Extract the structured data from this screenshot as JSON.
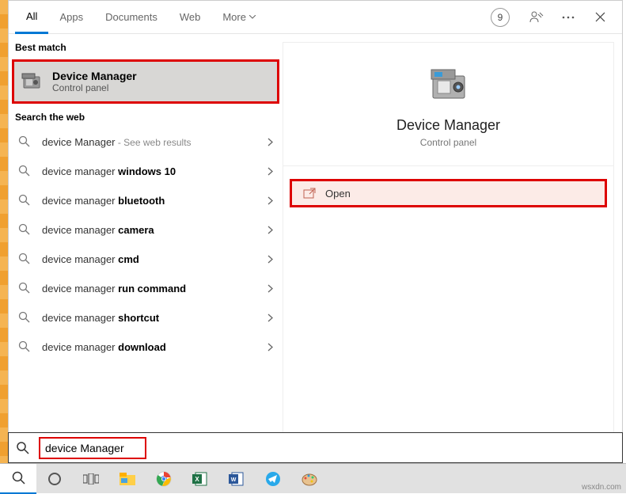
{
  "header": {
    "tabs": [
      "All",
      "Apps",
      "Documents",
      "Web",
      "More"
    ],
    "badge": "9"
  },
  "sections": {
    "best_match": "Best match",
    "search_web": "Search the web"
  },
  "best_match": {
    "title": "Device Manager",
    "subtitle": "Control panel"
  },
  "web_results": [
    {
      "prefix": "device Manager",
      "bold": "",
      "hint": " - See web results"
    },
    {
      "prefix": "device manager ",
      "bold": "windows 10",
      "hint": ""
    },
    {
      "prefix": "device manager ",
      "bold": "bluetooth",
      "hint": ""
    },
    {
      "prefix": "device manager ",
      "bold": "camera",
      "hint": ""
    },
    {
      "prefix": "device manager ",
      "bold": "cmd",
      "hint": ""
    },
    {
      "prefix": "device manager ",
      "bold": "run command",
      "hint": ""
    },
    {
      "prefix": "device manager ",
      "bold": "shortcut",
      "hint": ""
    },
    {
      "prefix": "device manager ",
      "bold": "download",
      "hint": ""
    }
  ],
  "preview": {
    "title": "Device Manager",
    "subtitle": "Control panel",
    "action": "Open"
  },
  "search_input": "device Manager",
  "watermark": "wsxdn.com"
}
